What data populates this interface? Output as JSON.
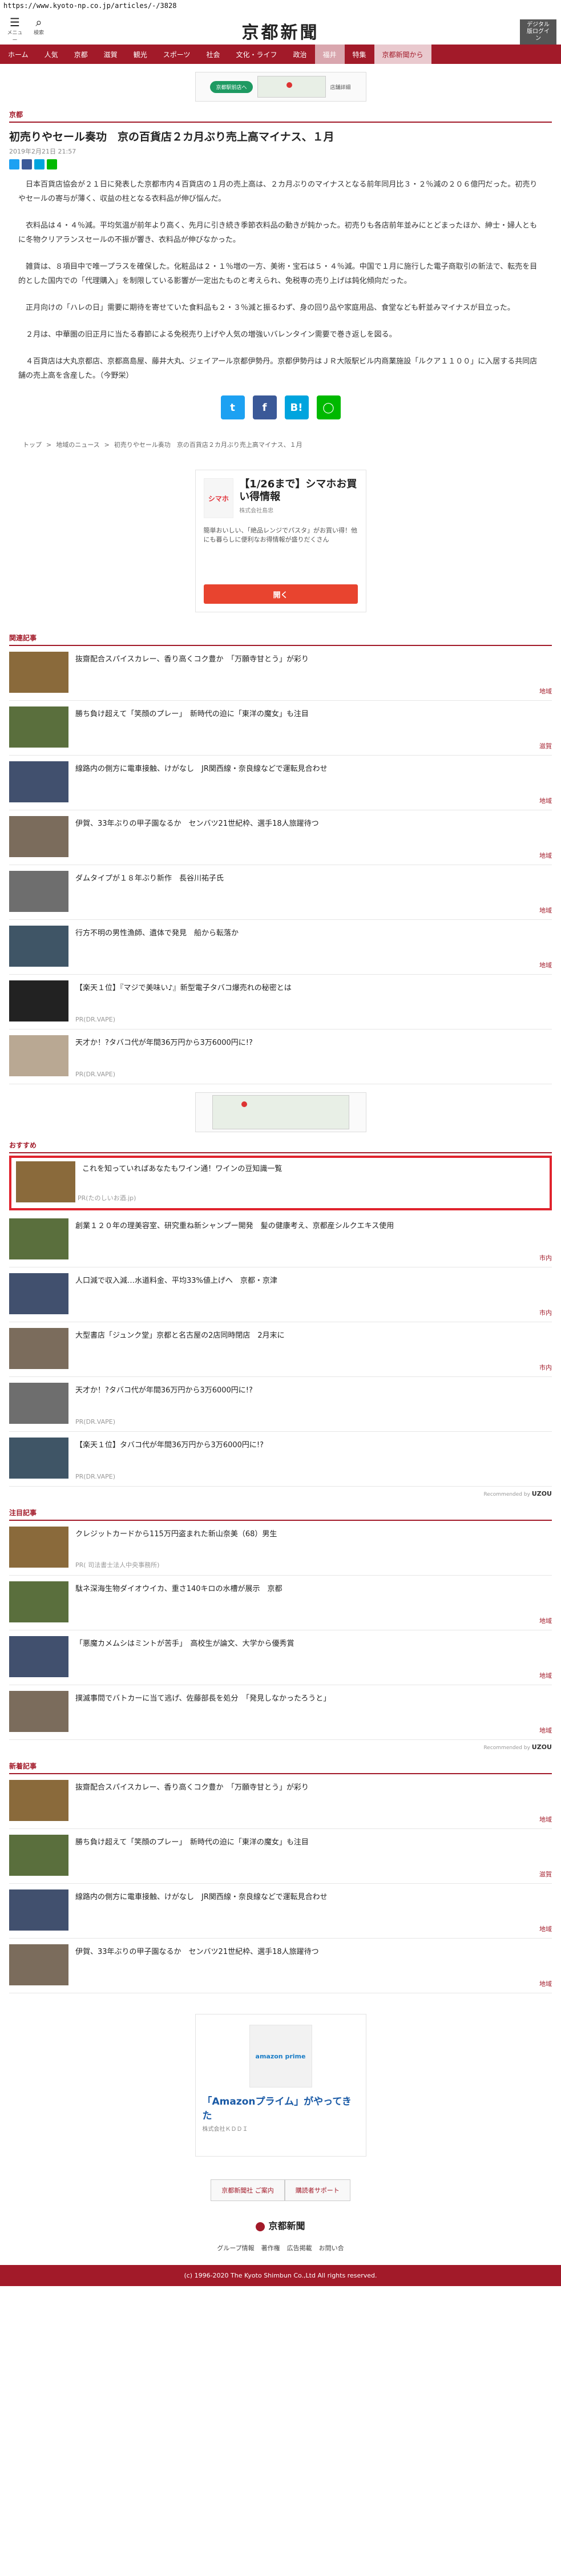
{
  "url": "https://www.kyoto-np.co.jp/articles/-/3828",
  "header": {
    "menu_label": "メニュー",
    "search_label": "検索",
    "logo": "京都新聞",
    "right_button": "デジタル版ログイン"
  },
  "nav": [
    "ホーム",
    "人気",
    "京都",
    "滋賀",
    "観光",
    "スポーツ",
    "社会",
    "文化・ライフ",
    "政治",
    "福井",
    "特集",
    "京都新聞から"
  ],
  "ad_banner": {
    "pill": "京都駅前店へ",
    "label": "店舗詳細"
  },
  "article": {
    "section": "京都",
    "title": "初売りやセール奏功　京の百貨店２カ月ぶり売上高マイナス、１月",
    "date": "2019年2月21日 21:57",
    "paragraphs": [
      "日本百貨店協会が２１日に発表した京都市内４百貨店の１月の売上高は、２カ月ぶりのマイナスとなる前年同月比３・２％減の２０６億円だった。初売りやセールの寄与が薄く、収益の柱となる衣料品が伸び悩んだ。",
      "衣料品は４・４％減。平均気温が前年より高く、先月に引き続き季節衣料品の動きが鈍かった。初売りも各店前年並みにとどまったほか、紳士・婦人ともに冬物クリアランスセールの不振が響き、衣料品が伸びなかった。",
      "雑貨は、８項目中で唯一プラスを確保した。化粧品は２・１％増の一方、美術・宝石は５・４％減。中国で１月に施行した電子商取引の新法で、転売を目的とした国内での「代理購入」を制限している影響が一定出たものと考えられ、免税専の売り上げは鈍化傾向だった。",
      "正月向けの「ハレの日」需要に期待を寄せていた食料品も２・３％減と振るわず、身の回り品や家庭用品、食堂なども軒並みマイナスが目立った。",
      "２月は、中華圏の旧正月に当たる春節による免税売り上げや人気の増強いバレンタイン需要で巻き返しを図る。",
      "４百貨店は大丸京都店、京都高島屋、藤井大丸、ジェイアール京都伊勢丹。京都伊勢丹はＪＲ大阪駅ビル内商業施設「ルクア１１００」に入居する共同店舗の売上高を含産した。（今野栄）"
    ]
  },
  "breadcrumb": [
    "トップ",
    "地域のニュース",
    "初売りやセール奏功　京の百貨店２カ月ぶり売上高マイナス、１月"
  ],
  "ad_shop": {
    "logo": "シマホ",
    "head": "【1/26まで】シマホお買い得情報",
    "sub": "株式会社島忠",
    "desc": "簡単おいしい、「絶品レンジでパスタ」がお買い得！他にも暮らしに便利なお得情報が盛りだくさん",
    "cta": "開く"
  },
  "related": {
    "label": "関連記事",
    "items": [
      {
        "title": "抜齋配合スパイスカレー、香り高くコク豊か　「万願寺甘とう」が彩り",
        "tag": "地域"
      },
      {
        "title": "勝ち負け超えて「笑顔のプレー」　新時代の迫に「東洋の魔女」も注目",
        "tag": "滋賀"
      },
      {
        "title": "線路内の側方に電車接触、けがなし　JR関西線・奈良線などで運転見合わせ",
        "tag": "地域"
      },
      {
        "title": "伊賀、33年ぶりの甲子園なるか　センバツ21世紀枠、選手18人旅躍待つ",
        "tag": "地域"
      },
      {
        "title": "ダムタイプが１８年ぶり新作　長谷川祐子氏",
        "tag": "地域"
      },
      {
        "title": "行方不明の男性漁師、遺体で発見　船から転落か",
        "tag": "地域"
      },
      {
        "title": "【楽天１位】『マジで美味い♪』新型電子タバコ爆売れの秘密とは",
        "pr": "PR(DR.VAPE)"
      },
      {
        "title": "天才か！?タバコ代が年間36万円から3万6000円に!?",
        "pr": "PR(DR.VAPE)"
      }
    ]
  },
  "recommended": {
    "label": "おすすめ",
    "items": [
      {
        "title": "これを知っていればあなたもワイン通！ワインの豆知識一覧",
        "pr": "PR(たのしいお酒.jp)"
      },
      {
        "title": "創業１２０年の理美容室、研究重ね新シャンプー開発　髪の健康考え、京都産シルクエキス使用",
        "tag": "市内"
      },
      {
        "title": "人口減で収入減…水道料金、平均33%値上げへ　京都・京津",
        "tag": "市内"
      },
      {
        "title": "大型書店「ジュンク堂」京都と名古屋の2店同時閉店　2月末に",
        "tag": "市内"
      },
      {
        "title": "天才か！?タバコ代が年間36万円から3万6000円に!?",
        "pr": "PR(DR.VAPE)"
      },
      {
        "title": "【楽天１位】タバコ代が年間36万円から3万6000円に!?",
        "pr": "PR(DR.VAPE)"
      }
    ],
    "powered": "Recommended by",
    "brand": "UZOU"
  },
  "notable": {
    "label": "注目記事",
    "items": [
      {
        "title": "クレジットカードから115万円盗まれた新山奈美（68）男生",
        "pr": "PR( 司法書士法人中央事務所)"
      },
      {
        "title": "駄ネ深海生物ダイオウイカ、重さ140キロの水槽が展示　京都",
        "tag": "地域"
      },
      {
        "title": "「悪魔カメムシはミントが苦手」　高校生が論文、大学から優秀賞",
        "tag": "地域"
      },
      {
        "title": "撲滅事問でバトカーに当て逃げ、佐藤部長を処分　「発見しなかったろうと」",
        "tag": "地域"
      }
    ],
    "powered": "Recommended by",
    "brand": "UZOU"
  },
  "latest": {
    "label": "新着記事",
    "items": [
      {
        "title": "抜齋配合スパイスカレー、香り高くコク豊か　「万願寺甘とう」が彩り",
        "tag": "地域"
      },
      {
        "title": "勝ち負け超えて「笑顔のプレー」　新時代の迫に「東洋の魔女」も注目",
        "tag": "滋賀"
      },
      {
        "title": "線路内の側方に電車接触、けがなし　JR関西線・奈良線などで運転見合わせ",
        "tag": "地域"
      },
      {
        "title": "伊賀、33年ぶりの甲子園なるか　センバツ21世紀枠、選手18人旅躍待つ",
        "tag": "地域"
      }
    ]
  },
  "ad_amazon": {
    "img_label": "amazon prime",
    "head": "「Amazonプライム」がやってきた",
    "sub": "株式会社ＫＤＤＩ"
  },
  "footer": {
    "links": [
      "京都新聞社 ご案内",
      "購読者サポート"
    ],
    "logo": "京都新聞",
    "nav": [
      "グループ情報",
      "著作権",
      "広告掲載",
      "お問い合"
    ],
    "copyright": "(c) 1996-2020 The Kyoto Shimbun Co.,Ltd All rights reserved."
  },
  "colors": {
    "brand": "#a21a29",
    "pr_red": "#e0232d"
  }
}
